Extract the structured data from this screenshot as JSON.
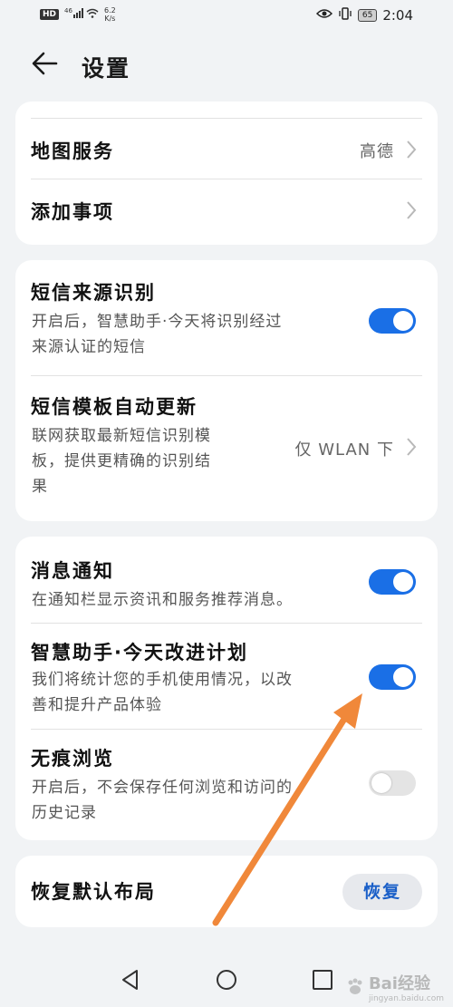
{
  "status_bar": {
    "network_badge": "HD",
    "signal": "⁴⁶ᐧıll",
    "speed_value": "6.2",
    "speed_unit": "K/s",
    "battery": "65",
    "time": "2:04"
  },
  "header": {
    "title": "设置"
  },
  "section_map": {
    "rows": [
      {
        "title": "地图服务",
        "value": "高德"
      },
      {
        "title": "添加事项",
        "value": ""
      }
    ]
  },
  "section_sms": {
    "source_id": {
      "title": "短信来源识别",
      "desc_line1": "开启后，智慧助手·今天将识别经过",
      "desc_line2": "来源认证的短信",
      "toggle": true
    },
    "template_update": {
      "title": "短信模板自动更新",
      "desc_line1": "联网获取最新短信识别模",
      "desc_line2": "板，提供更精确的识别结",
      "desc_line3": "果",
      "value": "仅 WLAN 下"
    }
  },
  "section_notify": {
    "notification": {
      "title": "消息通知",
      "desc_line1": "在通知栏显示资讯和服务推荐消息。",
      "toggle": true
    },
    "improvement": {
      "title": "智慧助手·今天改进计划",
      "desc_line1": "我们将统计您的手机使用情况，以改",
      "desc_line2": "善和提升产品体验",
      "toggle": true
    },
    "incognito": {
      "title": "无痕浏览",
      "desc_line1": "开启后，不会保存任何浏览和访问的",
      "desc_line2": "历史记录",
      "toggle": false
    }
  },
  "section_restore": {
    "title": "恢复默认布局",
    "button": "恢复"
  },
  "watermark": {
    "text": "Bai经验",
    "sub": "jingyan.baidu.com"
  },
  "colors": {
    "accent": "#1a6fe6",
    "arrow": "#f0883a",
    "background": "#f1f3f5"
  },
  "icons": [
    "back-arrow-icon",
    "chevron-right-icon",
    "nav-back-icon",
    "nav-home-icon",
    "nav-recents-icon"
  ]
}
